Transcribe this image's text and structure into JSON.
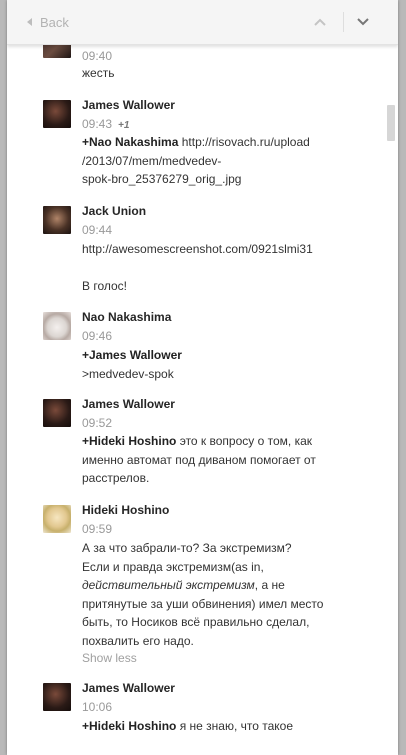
{
  "topbar": {
    "back_label": "Back"
  },
  "posts": [
    {
      "time": "09:40",
      "text": "жесть"
    },
    {
      "author": "James Wallower",
      "time": "09:43",
      "plusone": "+1",
      "mention": "+Nao Nakashima",
      "link_l1": "http://risovach.ru/upload",
      "link_l2": "/2013/07/mem/medvedev-",
      "link_l3": "spok-bro_25376279_orig_.jpg"
    },
    {
      "author": "Jack Union",
      "time": "09:44",
      "link": "http://awesomescreenshot.com/0921slmi31",
      "text2": "В голос!"
    },
    {
      "author": "Nao Nakashima",
      "time": "09:46",
      "mention": "+James Wallower",
      "text": ">medvedev-spok"
    },
    {
      "author": "James Wallower",
      "time": "09:52",
      "mention": "+Hideki Hoshino",
      "text_l1": "это к вопросу о том, как",
      "text_l2": "именно автомат под диваном помогает от",
      "text_l3": "расстрелов."
    },
    {
      "author": "Hideki Hoshino",
      "time": "09:59",
      "l1": "А за что забрали-то? За экстремизм?",
      "l2": "Если и правда экстремизм(as in,",
      "l3_em": "действительный экстремизм",
      "l3_rest": ", а не",
      "l4": "притянутые за уши обвинения) имел место",
      "l5": "быть, то Носиков всё правильно сделал,",
      "l6": "похвалить его надо.",
      "show_less": "Show less"
    },
    {
      "author": "James Wallower",
      "time": "10:06",
      "mention": "+Hideki Hoshino",
      "text": "я не знаю, что такое"
    }
  ]
}
